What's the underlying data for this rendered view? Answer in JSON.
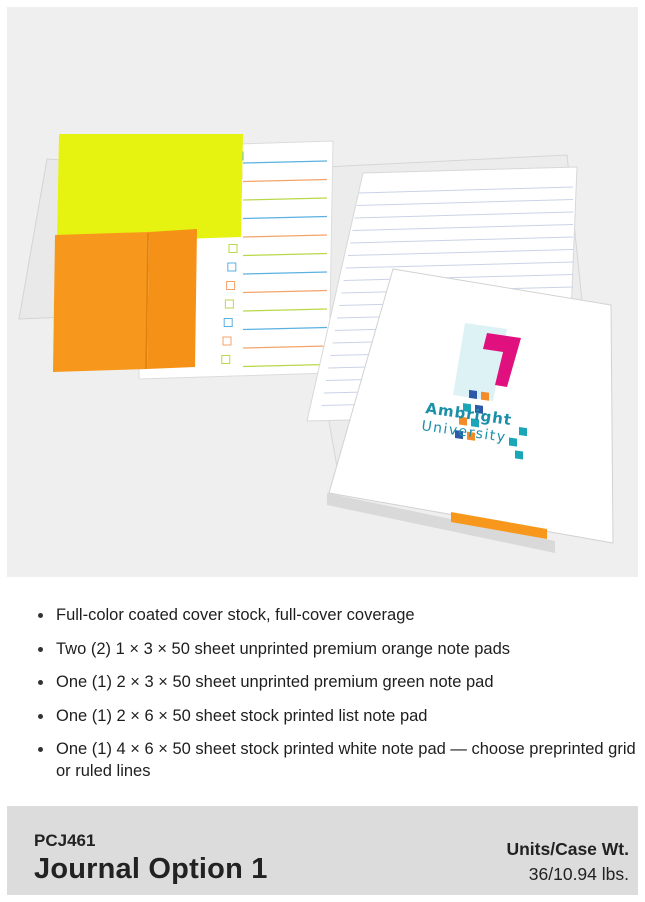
{
  "product_image": {
    "logo_text_line1": "Ambright",
    "logo_text_line2": "University",
    "colors": {
      "background": "#efefef",
      "green_pad": "#e6f20f",
      "orange_pad": "#f7981d",
      "logo_pink": "#e0117f",
      "logo_teal": "#1aa6b7",
      "logo_blue": "#2d5aa8",
      "logo_orange": "#f28c28"
    }
  },
  "features": [
    "Full-color coated cover stock, full-cover coverage",
    "Two (2) 1 × 3 × 50 sheet unprinted premium orange note pads",
    "One (1) 2 × 3 × 50 sheet unprinted premium green note pad",
    "One (1) 2 × 6 × 50 sheet stock printed list note pad",
    "One (1) 4 × 6 × 50 sheet stock printed white note pad — choose preprinted grid or ruled lines"
  ],
  "footer": {
    "sku": "PCJ461",
    "title": "Journal Option 1",
    "spec_label": "Units/Case Wt.",
    "spec_value": "36/10.94 lbs."
  }
}
